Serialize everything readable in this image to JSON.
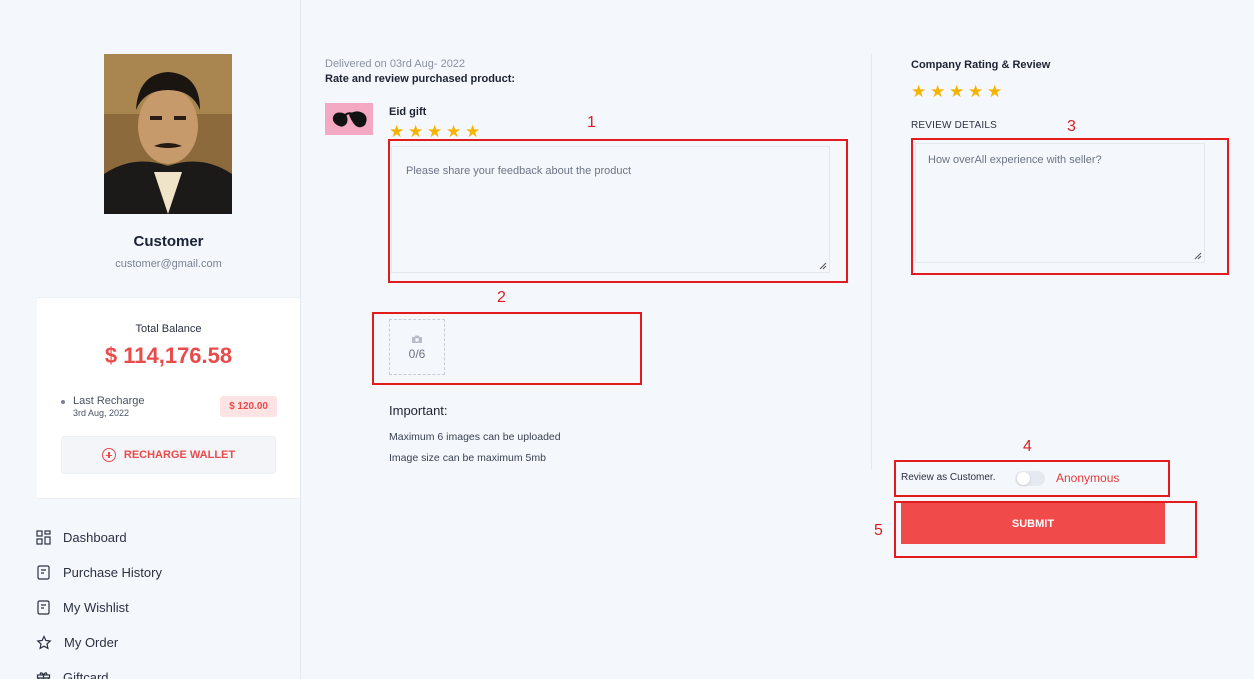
{
  "sidebar": {
    "customer_name": "Customer",
    "customer_email": "customer@gmail.com",
    "balance": {
      "label": "Total Balance",
      "value": "$ 114,176.58",
      "last_recharge_label": "Last Recharge",
      "last_recharge_date": "3rd Aug, 2022",
      "last_recharge_amount": "$ 120.00",
      "recharge_button": "RECHARGE WALLET"
    },
    "nav": [
      {
        "label": "Dashboard",
        "icon": "dashboard-icon"
      },
      {
        "label": "Purchase History",
        "icon": "receipt-icon"
      },
      {
        "label": "My Wishlist",
        "icon": "wishlist-icon"
      },
      {
        "label": "My Order",
        "icon": "star-icon"
      },
      {
        "label": "Giftcard",
        "icon": "gift-icon"
      }
    ]
  },
  "review": {
    "delivered": "Delivered on 03rd Aug- 2022",
    "title": "Rate and review purchased product:",
    "product_name": "Eid gift",
    "product_rating": 5,
    "feedback_placeholder": "Please share your feedback about the product",
    "upload_count": "0/6",
    "important_title": "Important:",
    "note_1": "Maximum 6 images can be uploaded",
    "note_2": "Image size can be maximum 5mb"
  },
  "company": {
    "title": "Company Rating & Review",
    "rating": 5,
    "details_label": "REVIEW DETAILS",
    "details_placeholder": "How overAll experience with seller?",
    "review_as_label": "Review as Customer.",
    "anonymous_label": "Anonymous",
    "anonymous_enabled": false,
    "submit_label": "SUBMIT"
  },
  "annotations": [
    "1",
    "2",
    "3",
    "4",
    "5"
  ],
  "colors": {
    "accent": "#f04a4a",
    "star": "#f6b400",
    "annotation": "#e01c1c"
  }
}
